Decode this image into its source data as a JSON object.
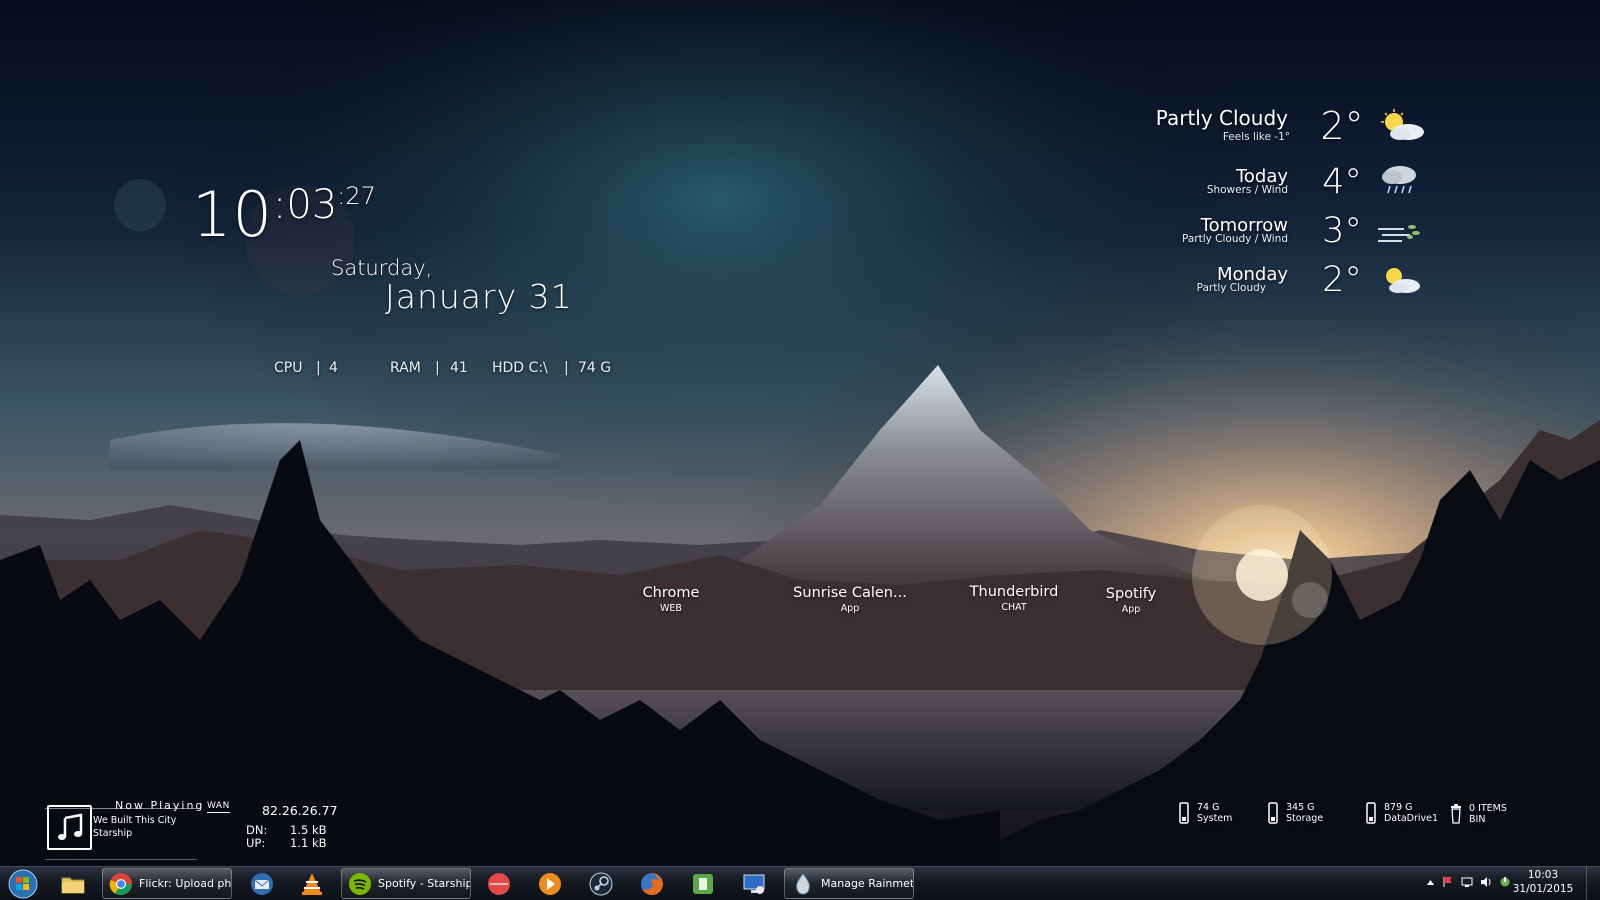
{
  "clock": {
    "hours": "10",
    "minutes": ":03",
    "seconds": ":27"
  },
  "date": {
    "weekday": "Saturday,",
    "full": "January 31"
  },
  "stats": {
    "cpu_label": "CPU",
    "cpu_value": "4",
    "ram_label": "RAM",
    "ram_value": "41",
    "hdd_label": "HDD C:\\",
    "hdd_value": "74 G",
    "separator": "|"
  },
  "weather": {
    "current": {
      "name": "Partly Cloudy",
      "sub": "Feels like -1°",
      "temp": "2°",
      "icon": "partly-cloudy-icon"
    },
    "days": [
      {
        "name": "Today",
        "sub": "Showers / Wind",
        "temp": "4°",
        "icon": "showers-icon"
      },
      {
        "name": "Tomorrow",
        "sub": "Partly Cloudy / Wind",
        "temp": "3°",
        "icon": "wind-icon"
      },
      {
        "name": "Monday",
        "sub": "Partly Cloudy",
        "temp": "2°",
        "icon": "partly-cloudy-icon"
      }
    ]
  },
  "launcher": [
    {
      "name": "Chrome",
      "caption": "WEB"
    },
    {
      "name": "Sunrise Calen...",
      "caption": "App"
    },
    {
      "name": "Thunderbird",
      "caption": "CHAT"
    },
    {
      "name": "Spotify",
      "caption": "App"
    }
  ],
  "now_playing": {
    "title": "Now Playing",
    "song": "We Built This City",
    "artist": "Starship",
    "icon": "music-note-icon"
  },
  "network": {
    "badge": "WAN",
    "ip": "82.26.26.77",
    "dn_label": "DN:",
    "dn_value": "1.5 kB",
    "up_label": "UP:",
    "up_value": "1.1 kB"
  },
  "drives": [
    {
      "size": "74 G",
      "name": "System"
    },
    {
      "size": "345 G",
      "name": "Storage"
    },
    {
      "size": "879 G",
      "name": "DataDrive1"
    }
  ],
  "bin": {
    "count": "0 ITEMS",
    "name": "BIN"
  },
  "taskbar": {
    "chrome_window": "Flickr: Upload ph...",
    "spotify_window": "Spotify - Starship ...",
    "rainmeter_window": "Manage Rainmeter",
    "clock_time": "10:03",
    "clock_date": "31/01/2015"
  },
  "colors": {
    "taskbar": "#141921",
    "accent": "#ffffff",
    "sky_top": "#0a1326",
    "teal_glow": "#2f6b78",
    "sunset": "#f0c48a"
  }
}
